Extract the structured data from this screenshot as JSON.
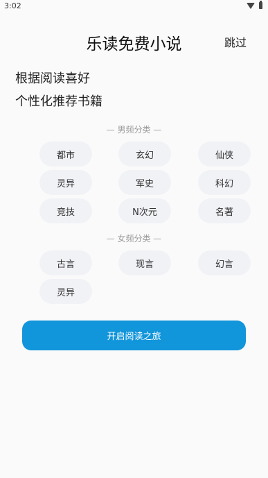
{
  "status": {
    "time": "3:02"
  },
  "header": {
    "title": "乐读免费小说",
    "skip_label": "跳过"
  },
  "tagline": {
    "line1": "根据阅读喜好",
    "line2": "个性化推荐书籍"
  },
  "male": {
    "label": "— 男频分类 —",
    "items": [
      "都市",
      "玄幻",
      "仙侠",
      "灵异",
      "军史",
      "科幻",
      "竞技",
      "N次元",
      "名著"
    ]
  },
  "female": {
    "label": "— 女频分类 —",
    "items": [
      "古言",
      "现言",
      "幻言",
      "灵异"
    ]
  },
  "start_button": {
    "label": "开启阅读之旅"
  },
  "colors": {
    "accent": "#1195db",
    "chip_bg": "#f1f2f6"
  },
  "icons": [
    "wifi-icon",
    "battery-icon"
  ]
}
